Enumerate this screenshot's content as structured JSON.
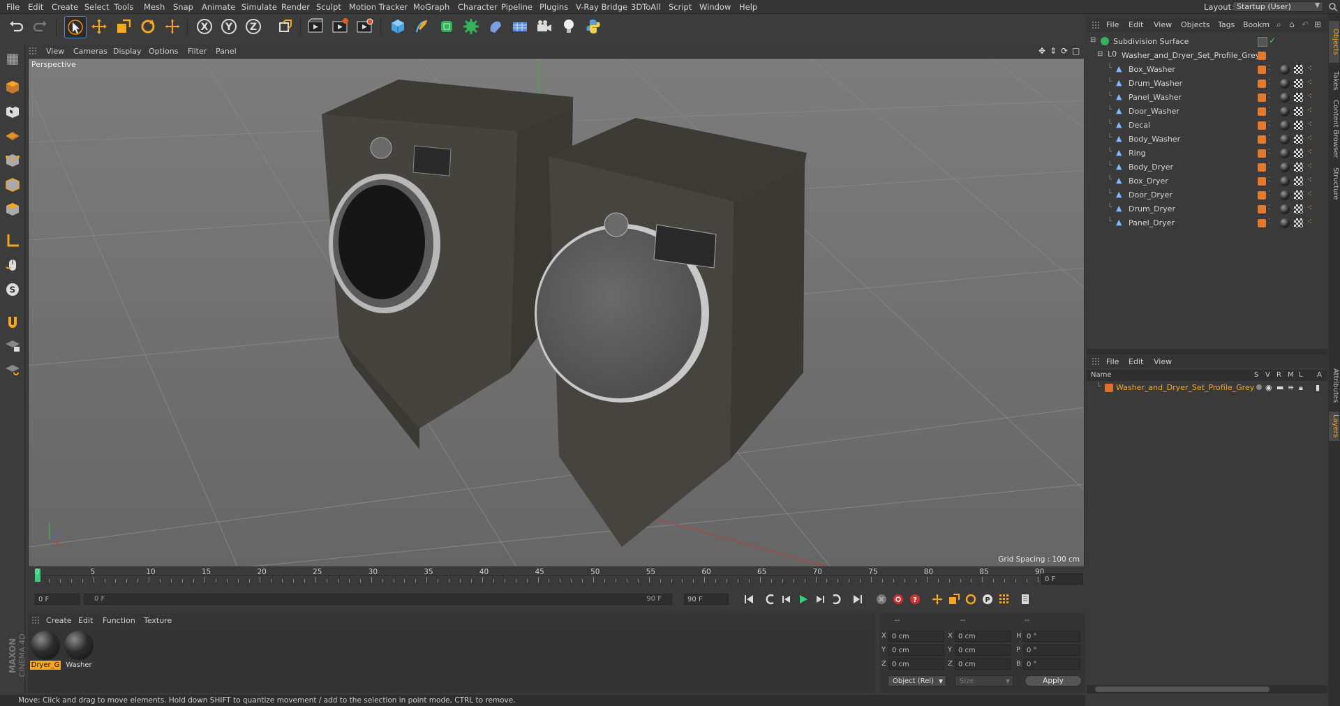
{
  "menubar": {
    "items": [
      "File",
      "Edit",
      "Create",
      "Select",
      "Tools",
      "Mesh",
      "Snap",
      "Animate",
      "Simulate",
      "Render",
      "Sculpt",
      "Motion Tracker",
      "MoGraph",
      "Character",
      "Pipeline",
      "Plugins",
      "V-Ray Bridge",
      "3DToAll",
      "Script",
      "Window",
      "Help"
    ],
    "layout_label": "Layout:",
    "layout_value": "Startup (User)"
  },
  "viewport": {
    "menu": [
      "View",
      "Cameras",
      "Display",
      "Options",
      "Filter",
      "Panel"
    ],
    "label": "Perspective",
    "grid_spacing": "Grid Spacing : 100 cm"
  },
  "timeline": {
    "ticks": [
      "0",
      "5",
      "10",
      "15",
      "20",
      "25",
      "30",
      "35",
      "40",
      "45",
      "50",
      "55",
      "60",
      "65",
      "70",
      "75",
      "80",
      "85",
      "90"
    ],
    "current_frame": "0 F",
    "start_field": "0 F",
    "range_start": "0 F",
    "range_end": "90 F",
    "end_field": "90 F"
  },
  "materials": {
    "menu": [
      "Create",
      "Edit",
      "Function",
      "Texture"
    ],
    "items": [
      {
        "name": "Dryer_G",
        "selected": true
      },
      {
        "name": "Washer",
        "selected": false
      }
    ],
    "brand": "MAXON",
    "product": "CINEMA 4D"
  },
  "coords": {
    "headers": [
      "--",
      "--",
      "--"
    ],
    "rows": [
      {
        "axis": "X",
        "pos": "0 cm",
        "axis2": "X",
        "size": "0 cm",
        "rot_axis": "H",
        "rot": "0 °"
      },
      {
        "axis": "Y",
        "pos": "0 cm",
        "axis2": "Y",
        "size": "0 cm",
        "rot_axis": "P",
        "rot": "0 °"
      },
      {
        "axis": "Z",
        "pos": "0 cm",
        "axis2": "Z",
        "size": "0 cm",
        "rot_axis": "B",
        "rot": "0 °"
      }
    ],
    "mode": "Object (Rel)",
    "size_mode": "Size",
    "apply": "Apply"
  },
  "status": "Move: Click and drag to move elements. Hold down SHIFT to quantize movement / add to the selection in point mode, CTRL to remove.",
  "object_manager": {
    "menu": [
      "File",
      "Edit",
      "View",
      "Objects",
      "Tags",
      "Bookm"
    ],
    "root": "Subdivision Surface",
    "group": "Washer_and_Dryer_Set_Profile_Grey",
    "children": [
      "Box_Washer",
      "Drum_Washer",
      "Panel_Washer",
      "Door_Washer",
      "Decal",
      "Body_Washer",
      "Ring",
      "Body_Dryer",
      "Box_Dryer",
      "Door_Dryer",
      "Drum_Dryer",
      "Panel_Dryer"
    ],
    "tag_color": "#e07a2e"
  },
  "layer_manager": {
    "menu": [
      "File",
      "Edit",
      "View"
    ],
    "headers": [
      "Name",
      "S",
      "V",
      "R",
      "M",
      "L",
      "A"
    ],
    "layers": [
      "Washer_and_Dryer_Set_Profile_Grey"
    ],
    "layer_color": "#e0702a"
  },
  "side_tabs": [
    "Objects",
    "Takes",
    "Content Browser",
    "Structure",
    "Attributes",
    "Layers"
  ]
}
